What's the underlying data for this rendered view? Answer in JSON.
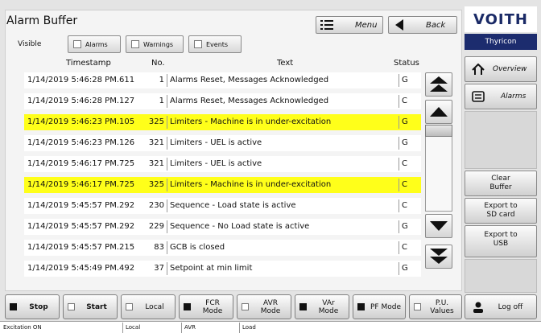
{
  "header": {
    "title": "Alarm Buffer",
    "menu_label": "Menu",
    "back_label": "Back"
  },
  "filters": {
    "visible_label": "Visible",
    "items": [
      "Alarms",
      "Warnings",
      "Events"
    ]
  },
  "columns": {
    "timestamp": "Timestamp",
    "no": "No.",
    "text": "Text",
    "status": "Status"
  },
  "rows": [
    {
      "timestamp": "1/14/2019 5:46:28 PM.611",
      "no": "1",
      "text": "Alarms Reset, Messages Acknowledged",
      "status": "G",
      "highlight": false
    },
    {
      "timestamp": "1/14/2019 5:46:28 PM.127",
      "no": "1",
      "text": "Alarms Reset, Messages Acknowledged",
      "status": "C",
      "highlight": false
    },
    {
      "timestamp": "1/14/2019 5:46:23 PM.105",
      "no": "325",
      "text": "Limiters - Machine is in under-excitation",
      "status": "G",
      "highlight": true
    },
    {
      "timestamp": "1/14/2019 5:46:23 PM.126",
      "no": "321",
      "text": "Limiters - UEL is active",
      "status": "G",
      "highlight": false
    },
    {
      "timestamp": "1/14/2019 5:46:17 PM.725",
      "no": "321",
      "text": "Limiters - UEL is active",
      "status": "C",
      "highlight": false
    },
    {
      "timestamp": "1/14/2019 5:46:17 PM.725",
      "no": "325",
      "text": "Limiters - Machine is in under-excitation",
      "status": "C",
      "highlight": true
    },
    {
      "timestamp": "1/14/2019 5:45:57 PM.292",
      "no": "230",
      "text": "Sequence - Load state is active",
      "status": "C",
      "highlight": false
    },
    {
      "timestamp": "1/14/2019 5:45:57 PM.292",
      "no": "229",
      "text": "Sequence - No Load state is active",
      "status": "G",
      "highlight": false
    },
    {
      "timestamp": "1/14/2019 5:45:57 PM.215",
      "no": "83",
      "text": "GCB is closed",
      "status": "C",
      "highlight": false
    },
    {
      "timestamp": "1/14/2019 5:45:49 PM.492",
      "no": "37",
      "text": "Setpoint at min limit",
      "status": "G",
      "highlight": false
    }
  ],
  "sidebar": {
    "logo": "VOITH",
    "product": "Thyricon",
    "overview_label": "Overview",
    "alarms_label": "Alarms",
    "clear_buffer_label": "Clear Buffer",
    "export_sd_label": "Export to SD card",
    "export_usb_label": "Export to USB"
  },
  "bottom_buttons": [
    {
      "label": "Stop",
      "indicator": "filled",
      "bold": true
    },
    {
      "label": "Start",
      "indicator": "empty",
      "bold": true
    },
    {
      "label": "Local",
      "indicator": "empty",
      "bold": false
    },
    {
      "label": "FCR Mode",
      "indicator": "filled",
      "bold": false
    },
    {
      "label": "AVR Mode",
      "indicator": "empty",
      "bold": false
    },
    {
      "label": "VAr Mode",
      "indicator": "filled",
      "bold": false
    },
    {
      "label": "PF Mode",
      "indicator": "filled",
      "bold": false
    },
    {
      "label": "P.U. Values",
      "indicator": "empty",
      "bold": false
    }
  ],
  "logoff_label": "Log off",
  "status_bar": [
    "Excitation ON",
    "Local",
    "AVR",
    "Load"
  ],
  "colors": {
    "highlight": "#ffff1a",
    "brand": "#1c2c6e"
  }
}
